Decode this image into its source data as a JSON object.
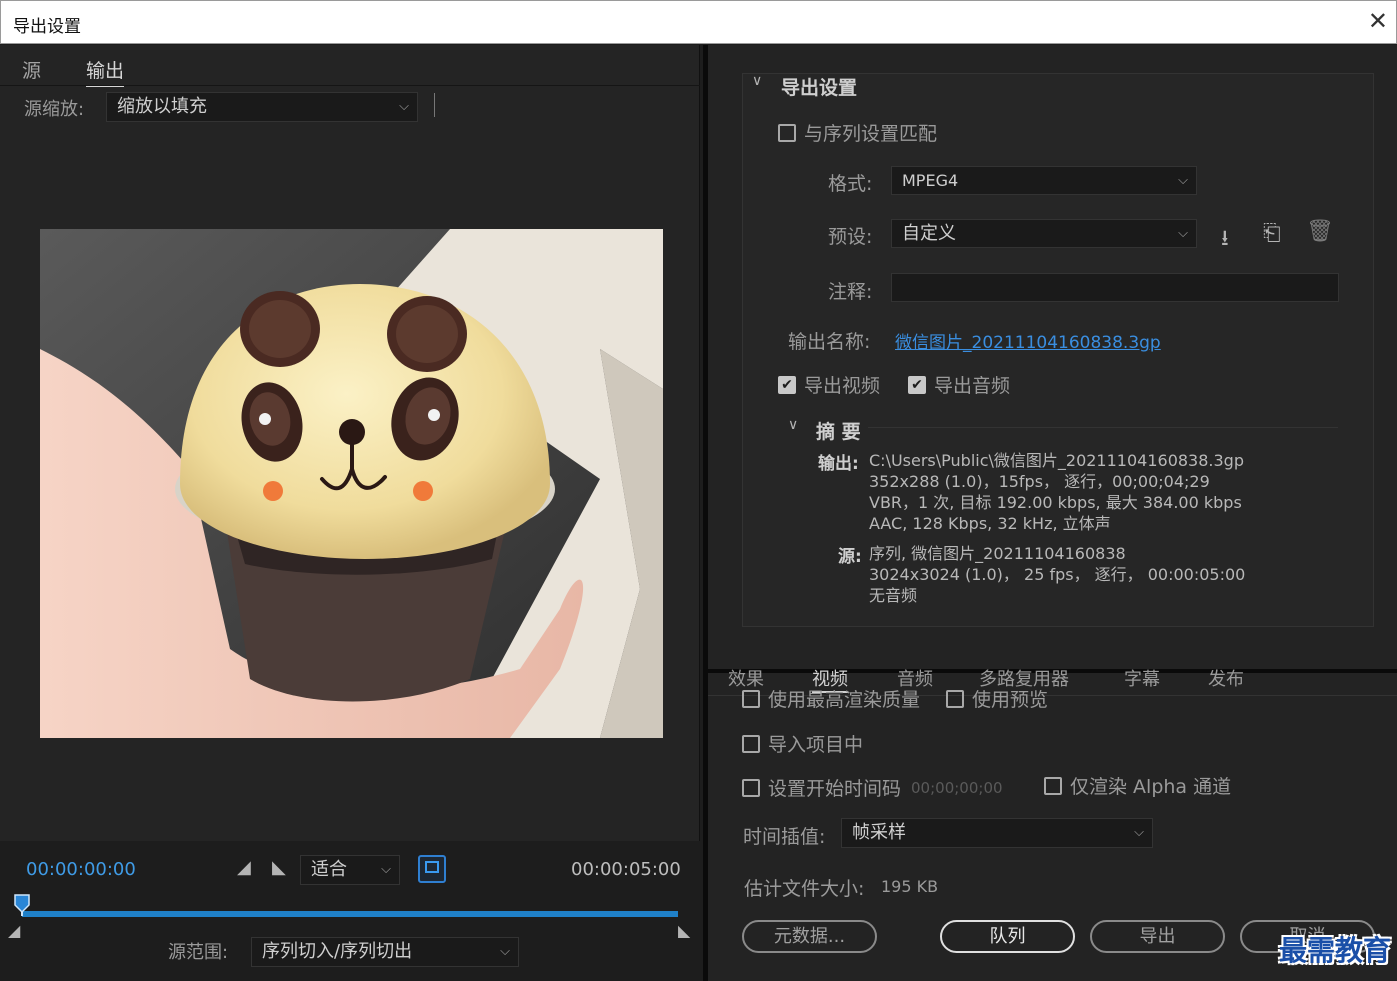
{
  "window": {
    "title": "导出设置",
    "close": "✕"
  },
  "left": {
    "tabs": [
      "源",
      "输出"
    ],
    "scale_label": "源缩放:",
    "scale_value": "缩放以填充",
    "timecode_start": "00:00:00:00",
    "timecode_end": "00:00:05:00",
    "fit_value": "适合",
    "range_label": "源范围:",
    "range_value": "序列切入/序列切出",
    "playhead_fraction": 0.0
  },
  "export_settings": {
    "heading": "导出设置",
    "match_sequence": "与序列设置匹配",
    "format_label": "格式:",
    "format_value": "MPEG4",
    "preset_label": "预设:",
    "preset_value": "自定义",
    "comment_label": "注释:",
    "comment_value": "",
    "output_name_label": "输出名称:",
    "output_name_value": "微信图片_20211104160838.3gp",
    "export_video": "导出视频",
    "export_audio": "导出音频",
    "summary_heading": "摘 要",
    "summary_output_label": "输出:",
    "summary_output_lines": [
      "C:\\Users\\Public\\微信图片_20211104160838.3gp",
      "352x288 (1.0)，15fps， 逐行，00;00;04;29",
      "VBR，1 次, 目标 192.00 kbps, 最大 384.00 kbps",
      "AAC, 128 Kbps, 32  kHz, 立体声"
    ],
    "summary_source_label": "源:",
    "summary_source_lines": [
      "序列, 微信图片_20211104160838",
      "3024x3024 (1.0)， 25 fps， 逐行， 00:00:05:00",
      "无音频"
    ]
  },
  "tabs_bottom": [
    "效果",
    "视频",
    "音频",
    "多路复用器",
    "字幕",
    "发布"
  ],
  "options": {
    "max_render": "使用最高渲染质量",
    "use_preview": "使用预览",
    "import_project": "导入项目中",
    "set_start_tc": "设置开始时间码",
    "start_tc_value": "00;00;00;00",
    "render_alpha": "仅渲染 Alpha 通道",
    "interp_label": "时间插值:",
    "interp_value": "帧采样",
    "filesize_label": "估计文件大小:",
    "filesize_value": "195 KB"
  },
  "buttons": {
    "metadata": "元数据...",
    "queue": "队列",
    "export": "导出",
    "cancel": "取消"
  },
  "watermark": "最需教育"
}
